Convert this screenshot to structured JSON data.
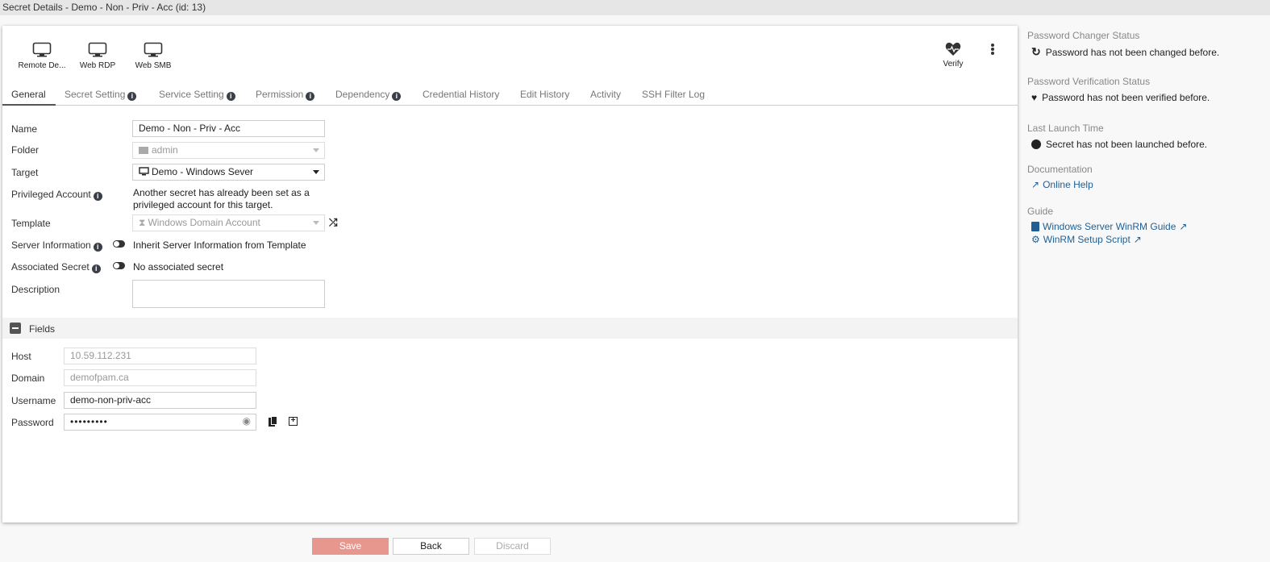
{
  "window_title": "Secret Details - Demo - Non - Priv - Acc (id: 13)",
  "launchers": [
    {
      "label": "Remote De..."
    },
    {
      "label": "Web RDP"
    },
    {
      "label": "Web SMB"
    }
  ],
  "verify_label": "Verify",
  "tabs": [
    {
      "label": "General"
    },
    {
      "label": "Secret Setting"
    },
    {
      "label": "Service Setting"
    },
    {
      "label": "Permission"
    },
    {
      "label": "Dependency"
    },
    {
      "label": "Credential History"
    },
    {
      "label": "Edit History"
    },
    {
      "label": "Activity"
    },
    {
      "label": "SSH Filter Log"
    }
  ],
  "form": {
    "name_label": "Name",
    "name_value": "Demo - Non - Priv - Acc",
    "folder_label": "Folder",
    "folder_value": "admin",
    "target_label": "Target",
    "target_value": "Demo - Windows Sever",
    "priv_label": "Privileged Account",
    "priv_text1": "Another secret has already been set as a",
    "priv_text2": "privileged account for this target.",
    "template_label": "Template",
    "template_value": "Windows Domain Account",
    "server_label": "Server Information",
    "server_text": "Inherit Server Information from Template",
    "assoc_label": "Associated Secret",
    "assoc_text": "No associated secret",
    "desc_label": "Description",
    "desc_value": ""
  },
  "fields": {
    "title": "Fields",
    "host_label": "Host",
    "host_value": "10.59.112.231",
    "domain_label": "Domain",
    "domain_value": "demofpam.ca",
    "username_label": "Username",
    "username_value": "demo-non-priv-acc",
    "password_label": "Password",
    "password_value": "•••••••••"
  },
  "side": {
    "changer_h": "Password Changer Status",
    "changer_t": "Password has not been changed before.",
    "verif_h": "Password Verification Status",
    "verif_t": "Password has not been verified before.",
    "launch_h": "Last Launch Time",
    "launch_t": "Secret has not been launched before.",
    "doc_h": "Documentation",
    "doc_link": "Online Help",
    "guide_h": "Guide",
    "guide_link1": "Windows Server WinRM Guide",
    "guide_link2": "WinRM Setup Script"
  },
  "buttons": {
    "save": "Save",
    "back": "Back",
    "discard": "Discard"
  },
  "colors": {
    "save": "#e8978f",
    "link": "#1f5f95"
  }
}
